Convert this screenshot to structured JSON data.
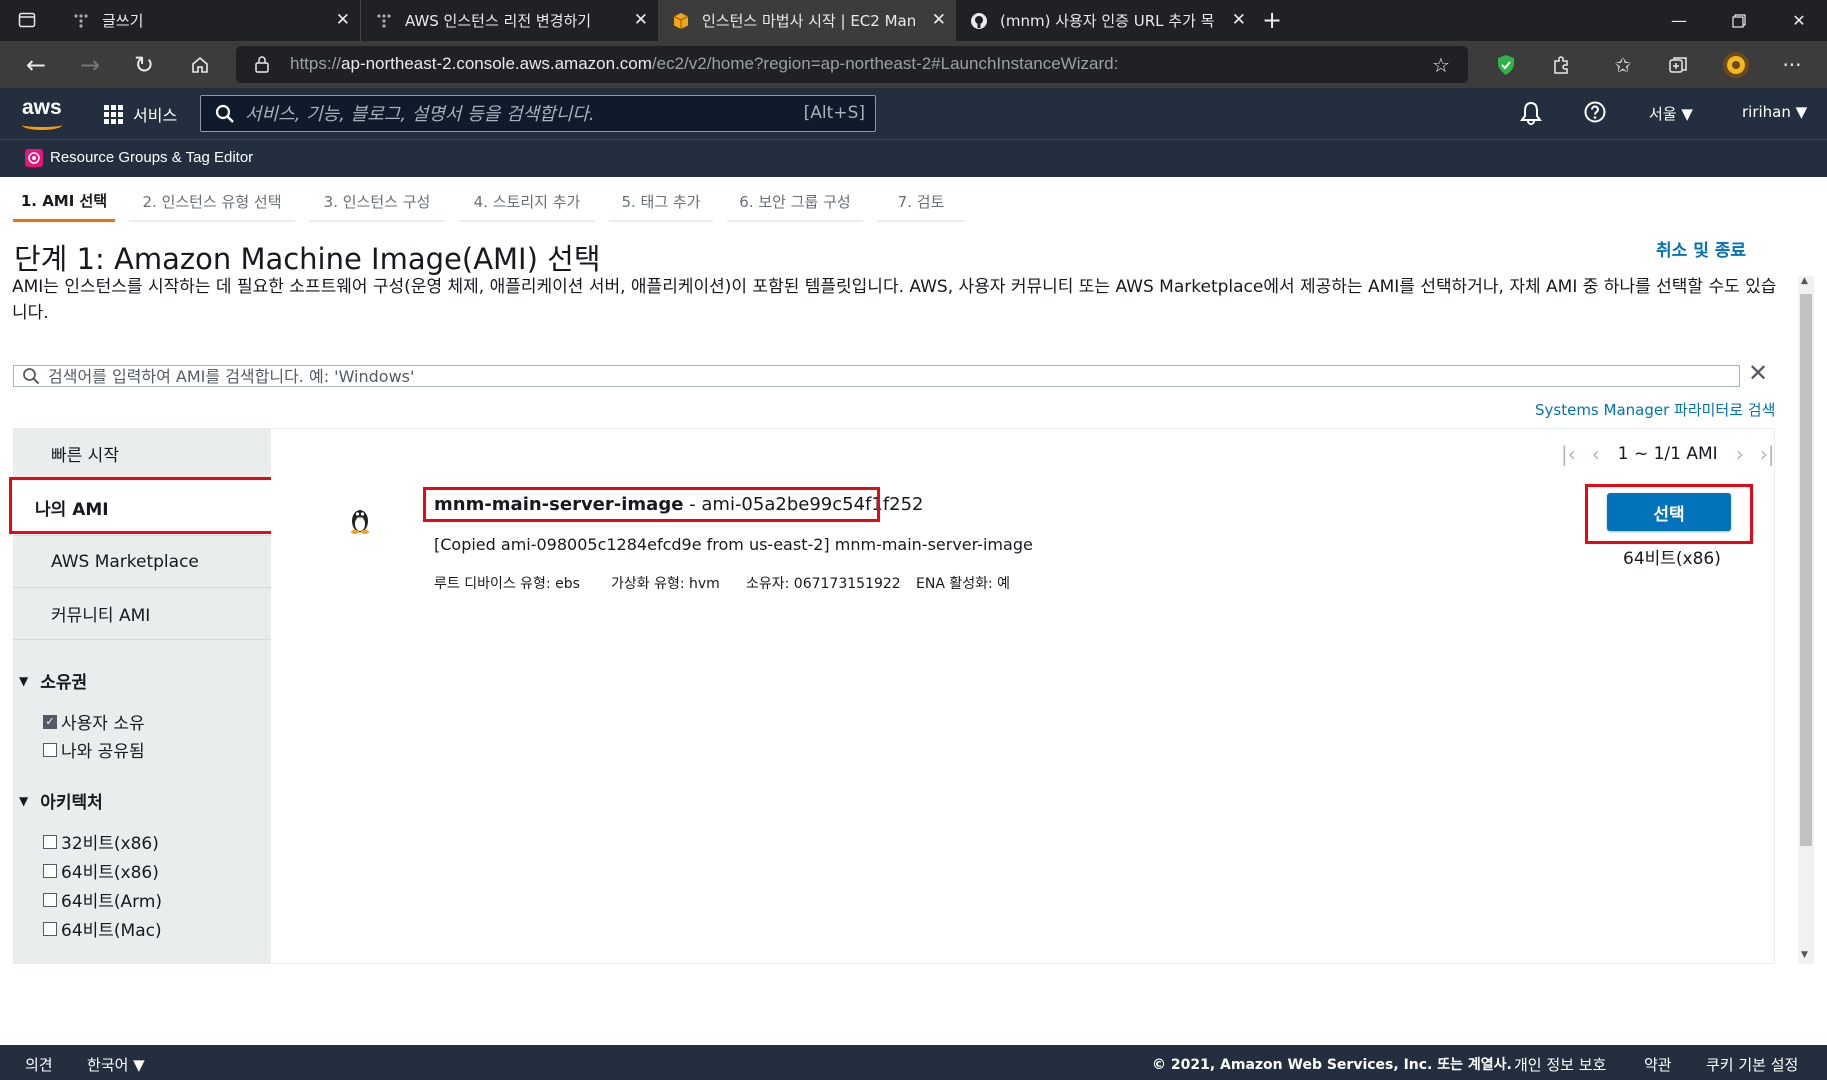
{
  "browser": {
    "tabs": [
      {
        "title": "글쓰기",
        "active": false
      },
      {
        "title": "AWS 인스턴스 리전 변경하기",
        "active": false
      },
      {
        "title": "인스턴스 마법사 시작 | EC2 Man",
        "active": true
      },
      {
        "title": "(mnm) 사용자 인증 URL 추가 목",
        "active": false
      }
    ],
    "new_tab": "+",
    "url_prefix": "https://",
    "url_host": "ap-northeast-2.console.aws.amazon.com",
    "url_path": "/ec2/v2/home?region=ap-northeast-2#LaunchInstanceWizard:"
  },
  "aws_header": {
    "logo": "aws",
    "services": "서비스",
    "search_placeholder": "서비스, 기능, 블로그, 설명서 등을 검색합니다.",
    "shortcut": "[Alt+S]",
    "region": "서울 ▼",
    "user": "ririhan ▼",
    "resource_groups": "Resource Groups & Tag Editor"
  },
  "wizard_tabs": [
    {
      "label": "1. AMI 선택",
      "active": true
    },
    {
      "label": "2. 인스턴스 유형 선택",
      "active": false
    },
    {
      "label": "3. 인스턴스 구성",
      "active": false
    },
    {
      "label": "4. 스토리지 추가",
      "active": false
    },
    {
      "label": "5. 태그 추가",
      "active": false
    },
    {
      "label": "6. 보안 그룹 구성",
      "active": false
    },
    {
      "label": "7. 검토",
      "active": false
    }
  ],
  "step": {
    "title": "단계 1: Amazon Machine Image(AMI) 선택",
    "cancel": "취소 및 종료",
    "description": "AMI는 인스턴스를 시작하는 데 필요한 소프트웨어 구성(운영 체제, 애플리케이션 서버, 애플리케이션)이 포함된 템플릿입니다. AWS, 사용자 커뮤니티 또는 AWS Marketplace에서 제공하는 AMI를 선택하거나, 자체 AMI 중 하나를 선택할 수도 있습니다.",
    "search_placeholder": "검색어를 입력하여 AMI를 검색합니다. 예: 'Windows'",
    "ssm_link": "Systems Manager 파라미터로 검색"
  },
  "left_nav": [
    {
      "label": "빠른 시작",
      "selected": false
    },
    {
      "label": "나의 AMI",
      "selected": true
    },
    {
      "label": "AWS Marketplace",
      "selected": false
    },
    {
      "label": "커뮤니티 AMI",
      "selected": false
    }
  ],
  "filters": {
    "ownership": {
      "title": "소유권",
      "items": [
        {
          "label": "사용자 소유",
          "checked": true
        },
        {
          "label": "나와 공유됨",
          "checked": false
        }
      ]
    },
    "architecture": {
      "title": "아키텍처",
      "items": [
        {
          "label": "32비트(x86)",
          "checked": false
        },
        {
          "label": "64비트(x86)",
          "checked": false
        },
        {
          "label": "64비트(Arm)",
          "checked": false
        },
        {
          "label": "64비트(Mac)",
          "checked": false
        }
      ]
    }
  },
  "pager": {
    "text": "1 ~ 1/1 AMI"
  },
  "ami": {
    "name": "mnm-main-server-image",
    "separator": " - ",
    "id": "ami-05a2be99c54f1f252",
    "description": "[Copied ami-098005c1284efcd9e from us-east-2] mnm-main-server-image",
    "root_device": "루트 디바이스 유형: ebs",
    "virtualization": "가상화 유형: hvm",
    "owner": "소유자: 067173151922",
    "ena": "ENA 활성화: 예",
    "select_label": "선택",
    "architecture": "64비트(x86)"
  },
  "footer": {
    "feedback": "의견",
    "language": "한국어 ▼",
    "copyright": "© 2021, Amazon Web Services, Inc. 또는 계열사.",
    "privacy": "개인 정보 보호",
    "terms": "약관",
    "cookies": "쿠키 기본 설정"
  },
  "colors": {
    "aws_navy": "#232f3e",
    "accent_orange": "#ec7211",
    "link_blue": "#0073bb",
    "highlight_red": "#e50914"
  }
}
